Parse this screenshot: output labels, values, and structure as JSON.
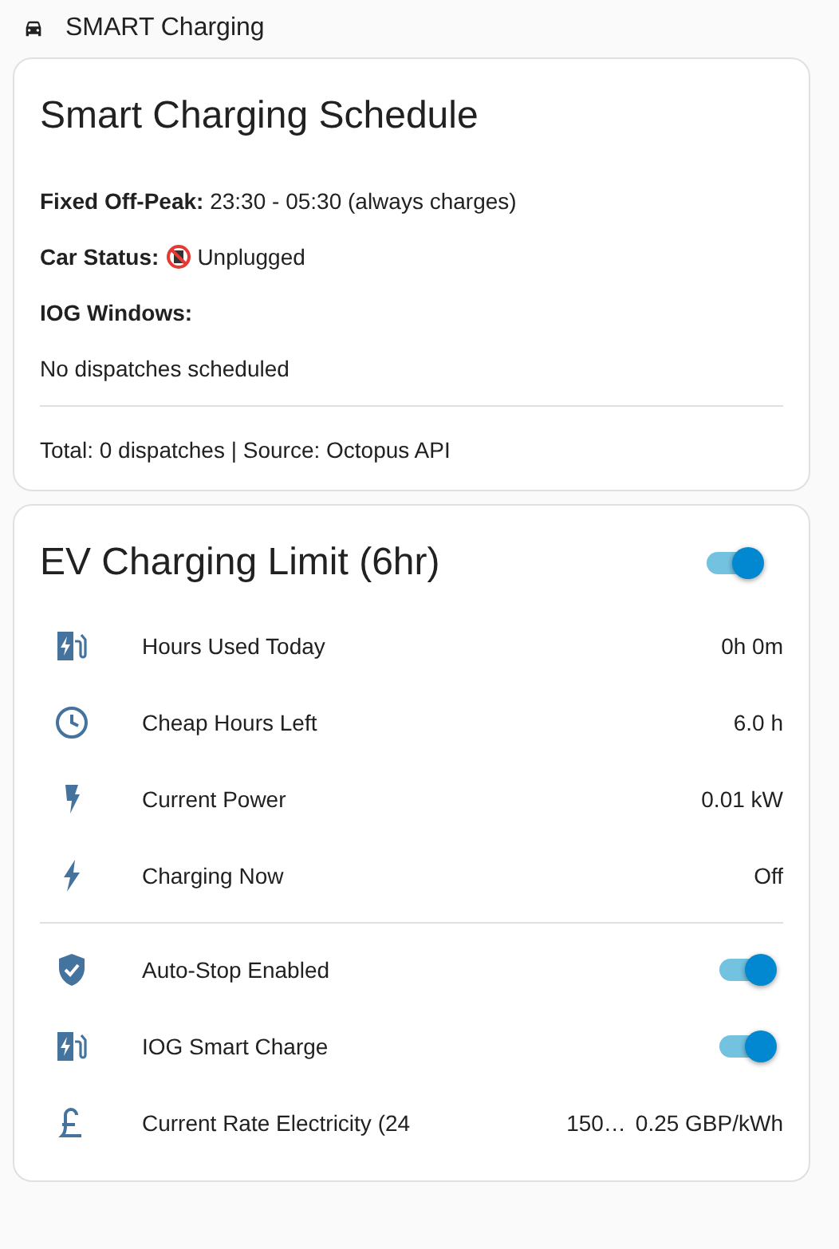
{
  "header": {
    "title": "SMART Charging"
  },
  "schedule_card": {
    "title": "Smart Charging Schedule",
    "lines": [
      {
        "kind": "text",
        "text": "**Fixed Off-Peak:** 23:30 - 05:30 (always charges)"
      },
      {
        "kind": "status",
        "label": "Car Status:",
        "value": "Unplugged",
        "plugged": false
      },
      {
        "kind": "heading",
        "text": "IOG Windows:"
      },
      {
        "kind": "text",
        "text": "No dispatches scheduled"
      }
    ],
    "footer": "Total: 0 dispatches | Source: Octopus API"
  },
  "limit_card": {
    "title": "EV Charging Limit (6hr)",
    "on": true,
    "sections": [
      [
        {
          "kind": "sensor",
          "label": "Hours Used Today",
          "value": "0h 0m"
        },
        {
          "kind": "sensor",
          "label": "Cheap Hours Left",
          "value": "6.0 h"
        },
        {
          "kind": "sensor",
          "label": "Current Power",
          "value": "0.01 kW"
        },
        {
          "kind": "sensor",
          "label": "Charging Now",
          "value": "Off"
        }
      ],
      [
        {
          "kind": "toggle",
          "label": "Auto-Stop Enabled",
          "on": true
        },
        {
          "kind": "toggle",
          "label": "IOG Smart Charge",
          "on": true
        },
        {
          "kind": "sensor",
          "label": "Current Rate Electricity (24",
          "label_end": "150…",
          "value": "0.25 GBP/kWh"
        }
      ]
    ]
  }
}
